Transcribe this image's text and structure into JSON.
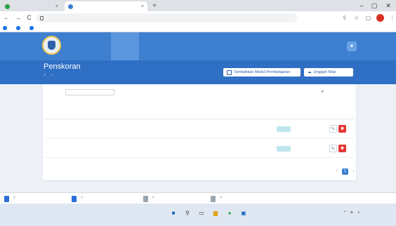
{
  "browser": {
    "tabs": [
      {
        "label": "",
        "active": false
      },
      {
        "label": "",
        "active": true
      }
    ],
    "new_tab": "+",
    "window_controls": [
      "–",
      "▢",
      "✕"
    ],
    "nav": {
      "back": "←",
      "forward": "→",
      "reload": "C"
    },
    "url": "",
    "bookmarks": [
      "",
      "",
      ""
    ]
  },
  "header": {
    "nav_items": [
      {
        "label": "",
        "active": false
      },
      {
        "label": "",
        "active": true
      },
      {
        "label": "",
        "active": false
      },
      {
        "label": "",
        "active": false
      },
      {
        "label": "",
        "active": false
      },
      {
        "label": "",
        "active": false
      }
    ],
    "school_name": ""
  },
  "page": {
    "title": "Penskoran",
    "breadcrumb": [
      "",
      ""
    ],
    "buttons": {
      "add_module": "Tambahkan Modul Pembelajaran",
      "upload_scores": "Unggah Nilai"
    }
  },
  "table_controls": {
    "length_label": "",
    "search_placeholder": "",
    "sort_label": ""
  },
  "table": {
    "headers": [
      "",
      "",
      "",
      "",
      "",
      ""
    ],
    "rows": [
      {
        "no": "",
        "date": "",
        "name": "",
        "teacher": "",
        "status": ""
      },
      {
        "no": "",
        "date": "",
        "name": "",
        "teacher": "",
        "status": ""
      }
    ]
  },
  "pagination": {
    "info": "",
    "pages": [
      "‹",
      "1",
      "›"
    ]
  },
  "footer": {
    "copyright": ""
  },
  "downloads": {
    "items": [
      "",
      "",
      "",
      ""
    ],
    "show_all": ""
  },
  "taskbar": {
    "weather": [
      "",
      ""
    ],
    "clock": [
      "",
      ""
    ]
  },
  "colors": {
    "header": "#3f7fd0",
    "title_band": "#2f6fc4",
    "status_badge": "#bfe6ef",
    "delete": "#e53935"
  }
}
